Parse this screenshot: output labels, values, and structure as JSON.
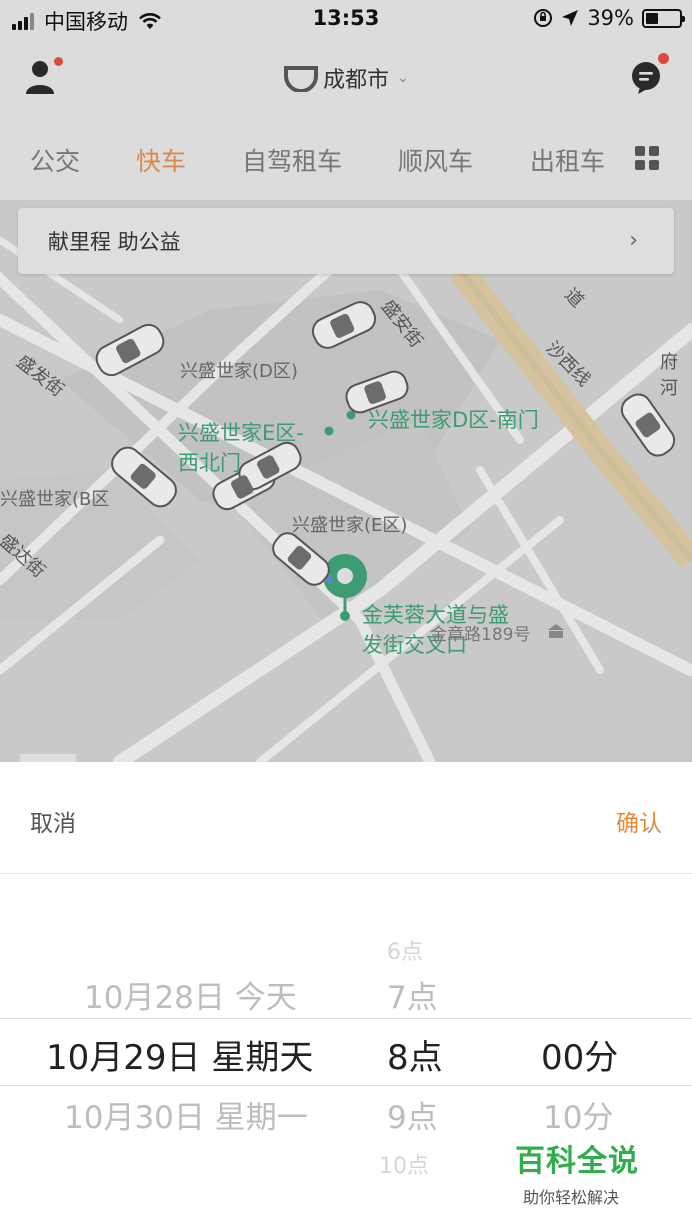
{
  "status_bar": {
    "carrier": "中国移动",
    "time": "13:53",
    "battery": "39%",
    "battery_level": 0.39
  },
  "header": {
    "city": "成都市"
  },
  "tabs": [
    {
      "label": "公交",
      "active": false
    },
    {
      "label": "快车",
      "active": true
    },
    {
      "label": "自驾租车",
      "active": false
    },
    {
      "label": "顺风车",
      "active": false
    },
    {
      "label": "出租车",
      "active": false
    }
  ],
  "map": {
    "banner": "献里程 助公益",
    "labels": {
      "street_shengfa": "盛发街",
      "street_shengan": "盛安街",
      "line_shaxi": "沙西线",
      "road_dao": "道",
      "fu_he": "府河",
      "area_d": "兴盛世家(D区)",
      "area_e": "兴盛世家(E区)",
      "area_b": "兴盛世家(B区",
      "street_shengda": "盛达街",
      "poi_e_nw_1": "兴盛世家E区-",
      "poi_e_nw_2": "西北门",
      "poi_d_south": "兴盛世家D区-南门",
      "pickup_1": "金芙蓉大道与盛",
      "pickup_2": "发街交叉口",
      "road_189": "金章路189号"
    }
  },
  "picker": {
    "cancel": "取消",
    "confirm": "确认",
    "day_prev": "10月28日 今天",
    "day_sel": "10月29日 星期天",
    "day_next": "10月30日 星期一",
    "hour_prev2": "6点",
    "hour_prev": "7点",
    "hour_sel": "8点",
    "hour_next": "9点",
    "hour_next2": "10点",
    "min_sel": "00分",
    "min_next": "10分"
  },
  "watermark": {
    "title": "百科全说",
    "subtitle": "助你轻松解决"
  },
  "colors": {
    "accent": "#E38A3B",
    "active_tab": "#D98A52",
    "map_green": "#3E9C74",
    "notification_dot": "#D94B3E",
    "watermark_green": "#2FAE4B"
  }
}
